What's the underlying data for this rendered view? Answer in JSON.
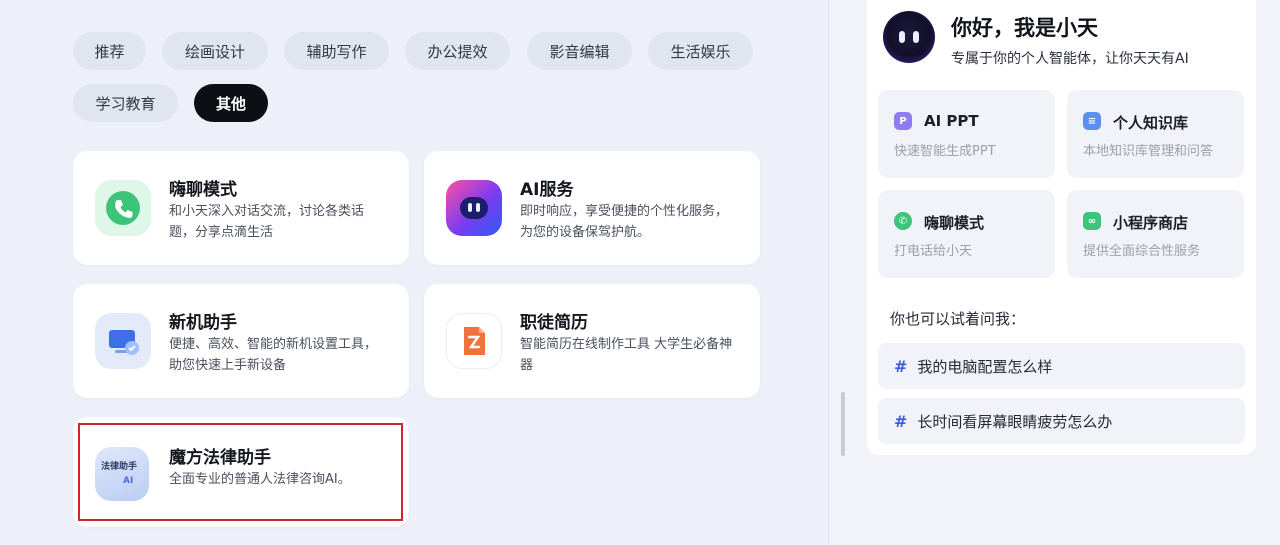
{
  "categories": [
    {
      "label": "推荐",
      "active": false
    },
    {
      "label": "绘画设计",
      "active": false
    },
    {
      "label": "辅助写作",
      "active": false
    },
    {
      "label": "办公提效",
      "active": false
    },
    {
      "label": "影音编辑",
      "active": false
    },
    {
      "label": "生活娱乐",
      "active": false
    },
    {
      "label": "学习教育",
      "active": false
    },
    {
      "label": "其他",
      "active": true
    }
  ],
  "apps": [
    {
      "title": "嗨聊模式",
      "desc": "和小天深入对话交流，讨论各类话题，分享点滴生活",
      "icon": "phone-chat-icon",
      "color": "#3cc57a"
    },
    {
      "title": "AI服务",
      "desc": "即时响应，享受便捷的个性化服务，为您的设备保驾护航。",
      "icon": "ai-robot-icon",
      "color": "#7a3cf0"
    },
    {
      "title": "新机助手",
      "desc": "便捷、高效、智能的新机设置工具，助您快速上手新设备",
      "icon": "new-device-icon",
      "color": "#3d6fe6"
    },
    {
      "title": "职徒简历",
      "desc": "智能简历在线制作工具 大学生必备神器",
      "icon": "resume-icon",
      "color": "#f0713a"
    },
    {
      "title": "魔方法律助手",
      "desc": "全面专业的普通人法律咨询AI。",
      "icon": "law-assistant-icon",
      "icon_text": "法律助手",
      "icon_small": "AI",
      "color": "#8aa8e6"
    }
  ],
  "assistant": {
    "greeting": "你好，我是小天",
    "subtitle": "专属于你的个人智能体，让你天天有AI",
    "features": [
      {
        "title": "AI PPT",
        "sub": "快速智能生成PPT",
        "icon": "ppt-icon",
        "color": "#8f7cf0",
        "glyph": "P"
      },
      {
        "title": "个人知识库",
        "sub": "本地知识库管理和问答",
        "icon": "knowledge-base-icon",
        "color": "#5b8ff0",
        "glyph": "≡"
      },
      {
        "title": "嗨聊模式",
        "sub": "打电话给小天",
        "icon": "phone-chat-icon",
        "color": "#3cc57a",
        "glyph": "✆"
      },
      {
        "title": "小程序商店",
        "sub": "提供全面综合性服务",
        "icon": "mini-program-store-icon",
        "color": "#3cc57a",
        "glyph": "∞"
      }
    ],
    "try_label": "你也可以试着问我：",
    "suggestions": [
      "我的电脑配置怎么样",
      "长时间看屏幕眼睛疲劳怎么办"
    ],
    "hash": "#"
  }
}
